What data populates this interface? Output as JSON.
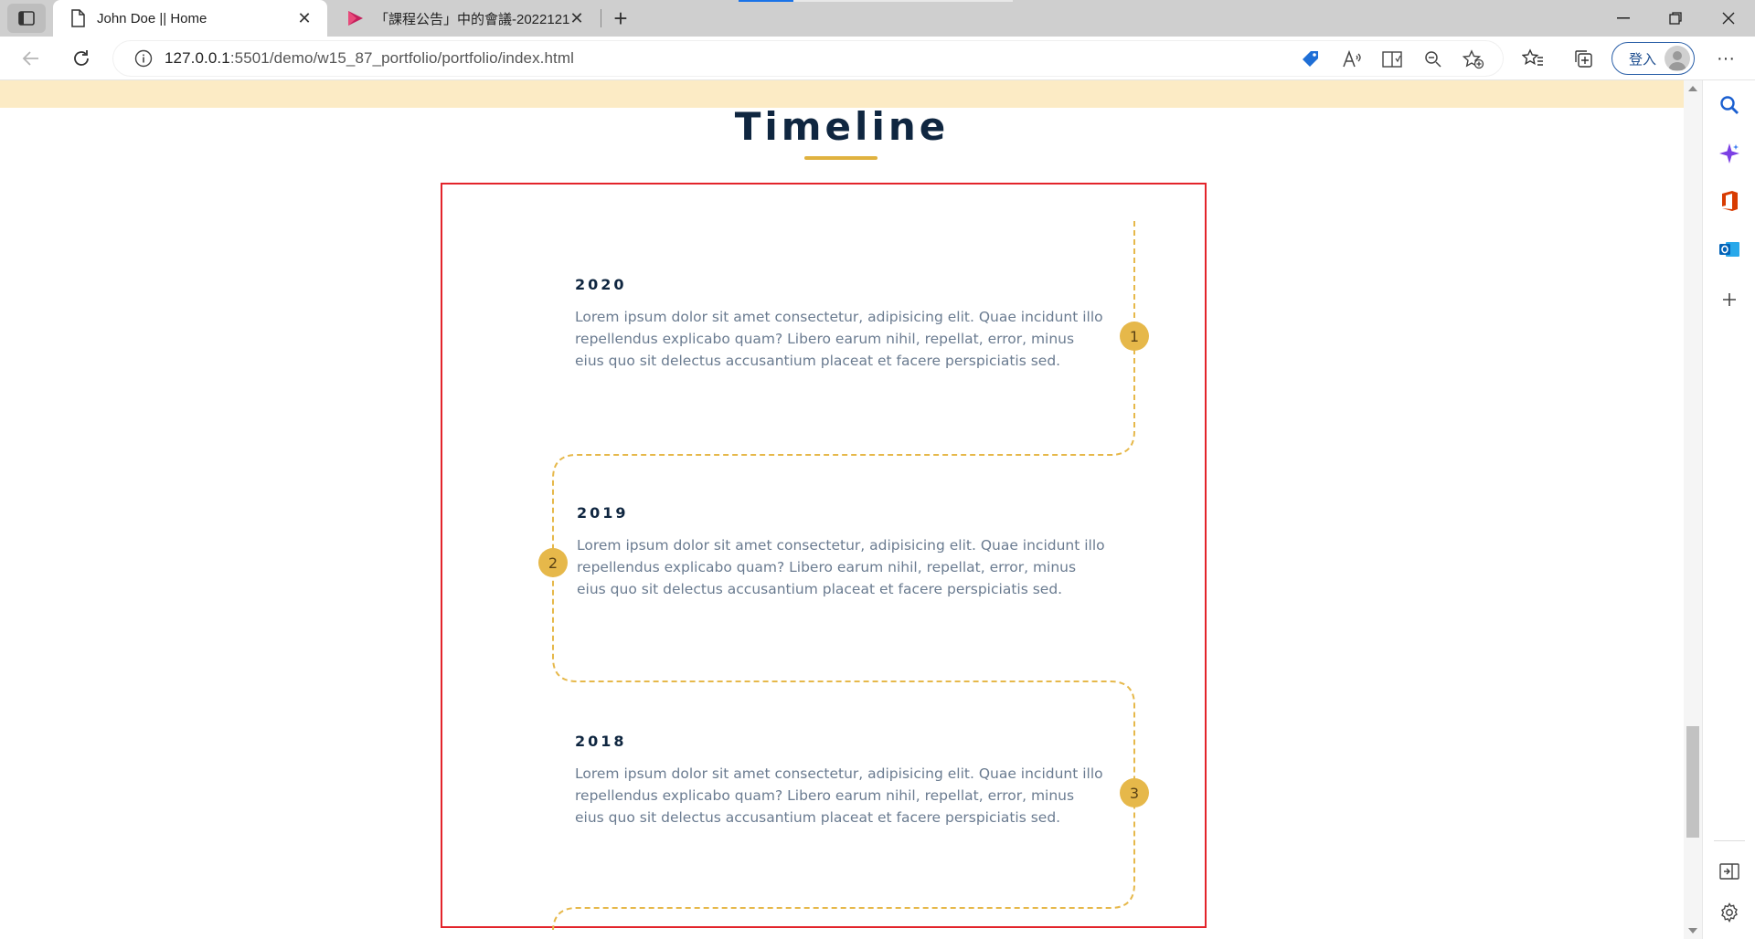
{
  "browser": {
    "tabs": [
      {
        "title": "John Doe || Home",
        "active": true,
        "icon": "page-icon"
      },
      {
        "title": "「課程公告」中的會議-2022121",
        "active": false,
        "icon": "stream-play-icon"
      }
    ],
    "new_tab_label": "+",
    "address": {
      "url_host": "127.0.0.1",
      "url_rest": ":5501/demo/w15_87_portfolio/portfolio/index.html"
    },
    "signin_label": "登入",
    "more_label": "···",
    "colors": {
      "accent": "#1a73e8",
      "signin": "#2a5fa8"
    }
  },
  "page": {
    "section_title": "Timeline",
    "colors": {
      "accent": "#e0b23f",
      "title": "#0f2640",
      "box_border": "#e3242b",
      "body_text": "#6a7b90"
    },
    "timeline": [
      {
        "year": "2020",
        "badge": "1",
        "text": "Lorem ipsum dolor sit amet consectetur, adipisicing elit. Quae incidunt illo repellendus explicabo quam? Libero earum nihil, repellat, error, minus eius quo sit delectus accusantium placeat et facere perspiciatis sed."
      },
      {
        "year": "2019",
        "badge": "2",
        "text": "Lorem ipsum dolor sit amet consectetur, adipisicing elit. Quae incidunt illo repellendus explicabo quam? Libero earum nihil, repellat, error, minus eius quo sit delectus accusantium placeat et facere perspiciatis sed."
      },
      {
        "year": "2018",
        "badge": "3",
        "text": "Lorem ipsum dolor sit amet consectetur, adipisicing elit. Quae incidunt illo repellendus explicabo quam? Libero earum nihil, repellat, error, minus eius quo sit delectus accusantium placeat et facere perspiciatis sed."
      }
    ]
  },
  "sidebar_icons": [
    "search-icon",
    "copilot-icon",
    "office-icon",
    "outlook-icon",
    "add-icon",
    "split-screen-icon",
    "settings-icon"
  ]
}
